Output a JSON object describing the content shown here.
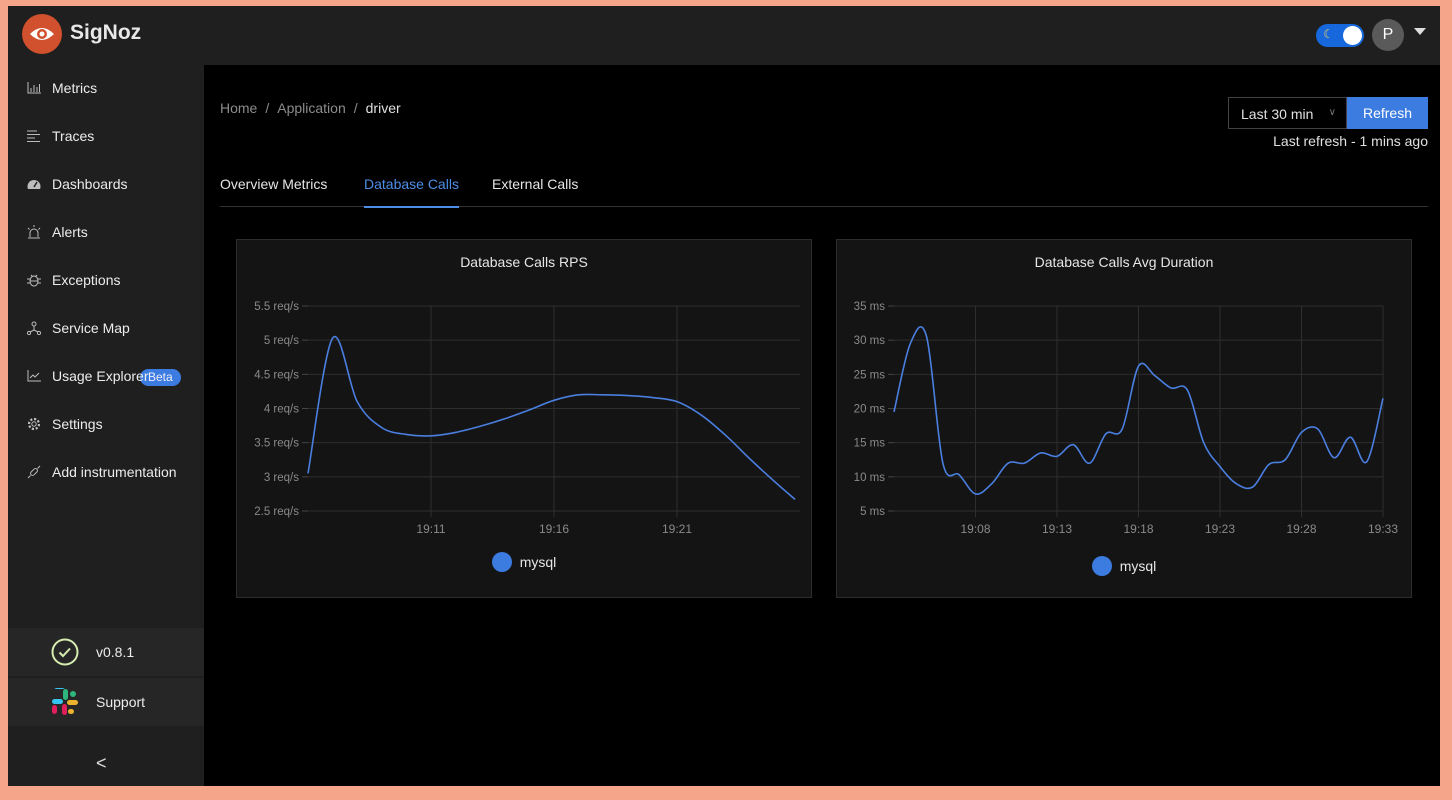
{
  "app": {
    "brand": "SigNoz",
    "avatar_initial": "P",
    "theme_toggle": "dark"
  },
  "sidebar": {
    "items": [
      {
        "label": "Metrics",
        "icon": "bar-chart-icon"
      },
      {
        "label": "Traces",
        "icon": "list-lines-icon"
      },
      {
        "label": "Dashboards",
        "icon": "dashboard-icon"
      },
      {
        "label": "Alerts",
        "icon": "alarm-icon"
      },
      {
        "label": "Exceptions",
        "icon": "bug-icon"
      },
      {
        "label": "Service Map",
        "icon": "network-icon",
        "badge": "Beta"
      },
      {
        "label": "Usage Explorer",
        "icon": "line-chart-icon"
      },
      {
        "label": "Settings",
        "icon": "gear-icon"
      },
      {
        "label": "Add instrumentation",
        "icon": "api-icon"
      }
    ],
    "version": "v0.8.1",
    "support": "Support",
    "collapse": "<"
  },
  "breadcrumb": {
    "items": [
      "Home",
      "Application",
      "driver"
    ],
    "separator": "/"
  },
  "toolbar": {
    "time_range": "Last 30 min",
    "refresh_label": "Refresh",
    "last_refresh": "Last refresh - 1 mins ago"
  },
  "tabs": [
    {
      "label": "Overview Metrics",
      "active": false
    },
    {
      "label": "Database Calls",
      "active": true
    },
    {
      "label": "External Calls",
      "active": false
    }
  ],
  "colors": {
    "accent": "#3c7be0",
    "series": "#4a7fe0"
  },
  "chart_data": [
    {
      "type": "line",
      "title": "Database Calls RPS",
      "xlabel": "",
      "ylabel": "",
      "unit": "req/s",
      "ylim": [
        2.5,
        5.5
      ],
      "yticks": [
        "5.5 req/s",
        "5 req/s",
        "4.5 req/s",
        "4 req/s",
        "3.5 req/s",
        "3 req/s",
        "2.5 req/s"
      ],
      "ytick_values": [
        5.5,
        5,
        4.5,
        4,
        3.5,
        3,
        2.5
      ],
      "xlim_minutes": [
        0,
        20
      ],
      "xticks": [
        {
          "label": "19:11",
          "min": 5
        },
        {
          "label": "19:16",
          "min": 10
        },
        {
          "label": "19:21",
          "min": 15
        }
      ],
      "grid": true,
      "legend": {
        "position": "bottom",
        "entries": [
          "mysql"
        ]
      },
      "series": [
        {
          "name": "mysql",
          "x_minutes": [
            0,
            1,
            2,
            3,
            4,
            5,
            6,
            7,
            8,
            9,
            10,
            11,
            12,
            13,
            14,
            15,
            16,
            17,
            18,
            19,
            19.8
          ],
          "values": [
            3.05,
            5.03,
            4.1,
            3.72,
            3.62,
            3.6,
            3.65,
            3.74,
            3.85,
            3.98,
            4.12,
            4.2,
            4.2,
            4.19,
            4.16,
            4.1,
            3.9,
            3.6,
            3.25,
            2.92,
            2.67
          ]
        }
      ]
    },
    {
      "type": "line",
      "title": "Database Calls Avg Duration",
      "xlabel": "",
      "ylabel": "",
      "unit": "ms",
      "ylim": [
        5,
        35
      ],
      "yticks": [
        "35 ms",
        "30 ms",
        "25 ms",
        "20 ms",
        "15 ms",
        "10 ms",
        "5 ms"
      ],
      "ytick_values": [
        35,
        30,
        25,
        20,
        15,
        10,
        5
      ],
      "xlim_minutes": [
        0,
        30
      ],
      "xticks": [
        {
          "label": "19:08",
          "min": 5
        },
        {
          "label": "19:13",
          "min": 10
        },
        {
          "label": "19:18",
          "min": 15
        },
        {
          "label": "19:23",
          "min": 20
        },
        {
          "label": "19:28",
          "min": 25
        },
        {
          "label": "19:33",
          "min": 30
        }
      ],
      "grid": true,
      "legend": {
        "position": "bottom",
        "entries": [
          "mysql"
        ]
      },
      "series": [
        {
          "name": "mysql",
          "x_minutes": [
            0,
            1,
            2,
            3,
            4,
            5,
            6,
            7,
            8,
            9,
            10,
            11,
            12,
            13,
            14,
            15,
            16,
            17,
            18,
            19,
            20,
            21,
            22,
            23,
            24,
            25,
            26,
            27,
            28,
            29,
            30
          ],
          "values": [
            19.5,
            29.5,
            30.5,
            12,
            10.3,
            7.5,
            9,
            12,
            12,
            13.5,
            13,
            14.7,
            12,
            16.3,
            17,
            26.2,
            24.8,
            23,
            22.7,
            15,
            11.5,
            9,
            8.5,
            11.8,
            12.5,
            16.5,
            17,
            12.8,
            15.8,
            12.2,
            21.5
          ]
        }
      ]
    }
  ]
}
